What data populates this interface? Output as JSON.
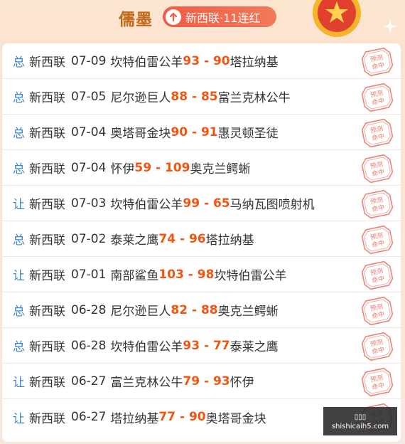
{
  "header": {
    "expert_name": "儒墨",
    "streak_label": "新西联·11连红",
    "colors": {
      "name": "#c06a1a",
      "badge": "#f25a45"
    }
  },
  "stamp_text": "预测命中",
  "colors": {
    "type": "#3a86d4",
    "score": "#f2550f",
    "stamp": "#e35c4e"
  },
  "records": [
    {
      "type": "总",
      "league": "新西联",
      "date": "07-09",
      "home": "坎特伯雷公羊",
      "score": "93 - 90",
      "away": "塔拉纳基"
    },
    {
      "type": "总",
      "league": "新西联",
      "date": "07-05",
      "home": "尼尔逊巨人",
      "score": "88 - 85",
      "away": "富兰克林公牛"
    },
    {
      "type": "总",
      "league": "新西联",
      "date": "07-04",
      "home": "奥塔哥金块",
      "score": "90 - 91",
      "away": "惠灵顿圣徒"
    },
    {
      "type": "总",
      "league": "新西联",
      "date": "07-04",
      "home": "怀伊",
      "score": "59 - 109",
      "away": "奥克兰鳄蜥"
    },
    {
      "type": "让",
      "league": "新西联",
      "date": "07-03",
      "home": "坎特伯雷公羊",
      "score": "99 - 65",
      "away": "马纳瓦图喷射机"
    },
    {
      "type": "总",
      "league": "新西联",
      "date": "07-02",
      "home": "泰莱之鹰",
      "score": "74 - 96",
      "away": "塔拉纳基"
    },
    {
      "type": "让",
      "league": "新西联",
      "date": "07-01",
      "home": "南部鲨鱼",
      "score": "103 - 98",
      "away": "坎特伯雷公羊"
    },
    {
      "type": "总",
      "league": "新西联",
      "date": "06-28",
      "home": "尼尔逊巨人",
      "score": "82 - 88",
      "away": "奥克兰鳄蜥"
    },
    {
      "type": "总",
      "league": "新西联",
      "date": "06-28",
      "home": "坎特伯雷公羊",
      "score": "93 - 77",
      "away": "泰莱之鹰"
    },
    {
      "type": "让",
      "league": "新西联",
      "date": "06-27",
      "home": "富兰克林公牛",
      "score": "79 - 93",
      "away": "怀伊"
    },
    {
      "type": "让",
      "league": "新西联",
      "date": "06-27",
      "home": "塔拉纳基",
      "score": "77 - 90",
      "away": "奥塔哥金块"
    }
  ],
  "watermark": {
    "line1": "▯▯▯",
    "line2": "shishicaih5.com"
  }
}
